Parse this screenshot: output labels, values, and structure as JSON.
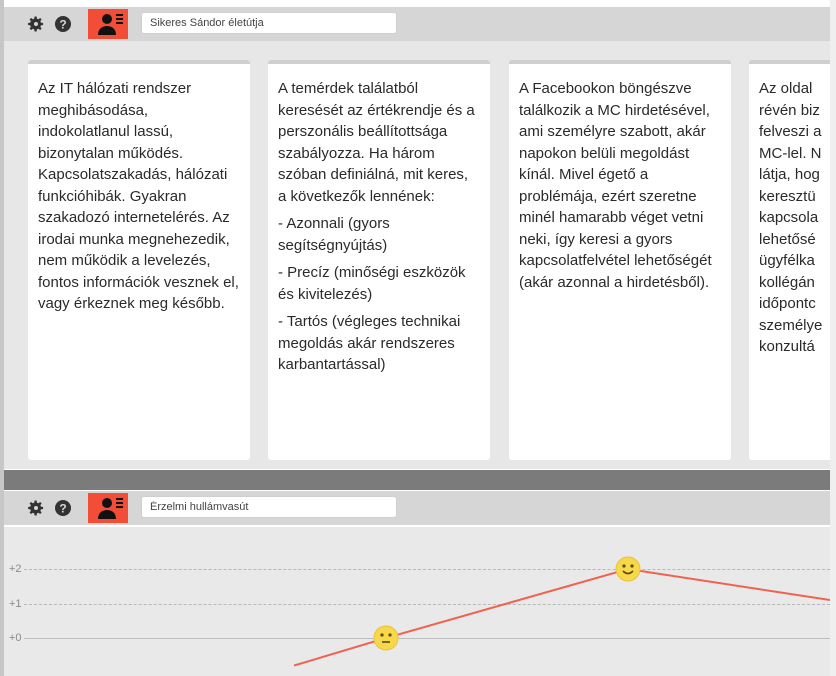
{
  "panel1": {
    "title_input": "Sikeres Sándor életútja",
    "cards": [
      {
        "text": "Az IT hálózati rendszer meghibásodása, indokolatlanul lassú, bizonytalan működés. Kapcsolatszakadás, hálózati funkcióhibák. Gyakran szakadozó internetelérés. Az irodai munka megnehezedik, nem működik a levelezés, fontos információk vesznek el, vagy érkeznek meg később."
      },
      {
        "text": "A temérdek találatból keresését az értékrendje és a perszonális beállítottsága szabályozza. Ha három szóban definiálná, mit keres, a következők lennének:",
        "items": [
          "- Azonnali (gyors segítségnyújtás)",
          "- Precíz (minőségi eszközök és kivitelezés)",
          "- Tartós (végleges technikai megoldás akár rendszeres karbantartással)"
        ]
      },
      {
        "text": "A Facebookon böngészve találkozik a MC hirdetésével, ami személyre szabott, akár napokon belüli megoldást kínál. Mivel égető a problémája, ezért szeretne minél hamarabb véget vetni neki, így keresi a gyors kapcsolatfelvétel lehetőségét (akár azonnal a hirdetésből)."
      },
      {
        "text": "Az oldal\nrévén biz\nfelveszi a\nMC-lel. N\nlátja, hog\nkeresztü\nkapcsola\nlehetősé\nügyfélka\nkollégán\nidőpontc\nszemélye\nkonzultá"
      }
    ]
  },
  "panel2": {
    "title_input": "Érzelmi hullámvasút",
    "ticks": [
      "+2",
      "+1",
      "+0"
    ],
    "chart_data": {
      "type": "line",
      "title": "Érzelmi hullámvasút",
      "y_ticks": [
        "+2",
        "+1",
        "+0"
      ],
      "points": [
        {
          "step": 0,
          "value": -0.8
        },
        {
          "step": 1,
          "value": 0,
          "emoji": "neutral"
        },
        {
          "step": 2,
          "value": 2,
          "emoji": "happy"
        },
        {
          "step": 3,
          "value": 1.1
        }
      ]
    }
  },
  "colors": {
    "accent": "#f14d37",
    "line": "#f0624f",
    "emoji": "#f6d84a",
    "toolbar": "#d6d6d6"
  },
  "icons": [
    "gear-icon",
    "help-icon",
    "persona-icon"
  ]
}
